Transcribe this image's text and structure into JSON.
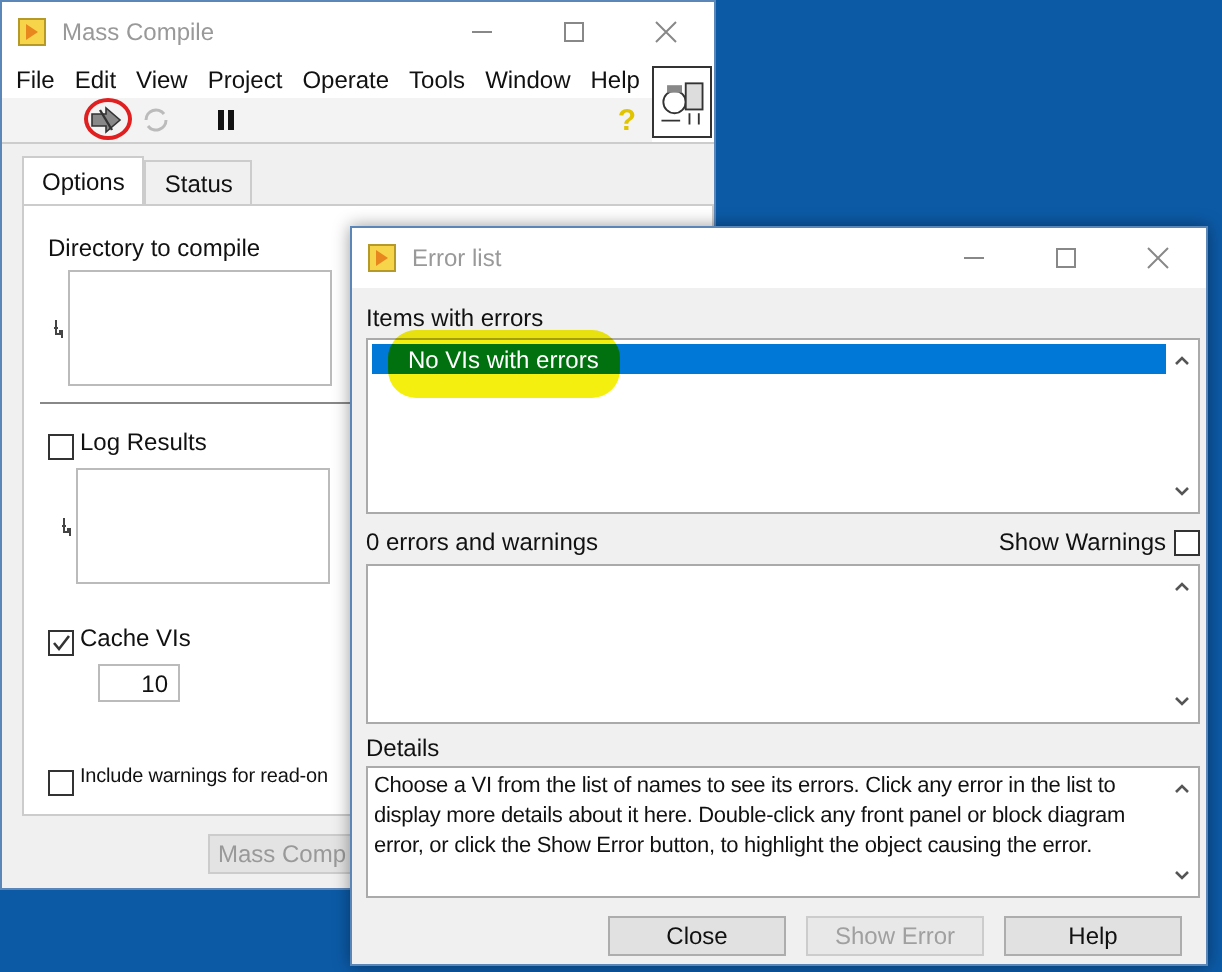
{
  "main_window": {
    "title": "Mass Compile",
    "menu": [
      "File",
      "Edit",
      "View",
      "Project",
      "Operate",
      "Tools",
      "Window",
      "Help"
    ],
    "help_glyph": "?",
    "tabs": [
      {
        "label": "Options",
        "selected": true
      },
      {
        "label": "Status",
        "selected": false
      }
    ],
    "directory_label": "Directory to compile",
    "log_results": {
      "label": "Log Results",
      "checked": false
    },
    "cache_vis": {
      "label": "Cache VIs",
      "checked": true,
      "value": "10"
    },
    "include_warnings": {
      "label": "Include warnings for read-on",
      "checked": false
    },
    "mass_compile_button": "Mass Comp"
  },
  "error_dialog": {
    "title": "Error list",
    "items_label": "Items with errors",
    "items": [
      {
        "label": "No VIs with errors",
        "selected": true
      }
    ],
    "count_label": "0 errors and warnings",
    "show_warnings": {
      "label": "Show Warnings",
      "checked": false
    },
    "details_label": "Details",
    "details_text": "Choose a VI from the list of names to see its errors. Click any error in the list to display more details about it here. Double-click any front panel or block diagram error, or click the Show Error button, to highlight the object causing the error.",
    "buttons": [
      {
        "label": "Close",
        "disabled": false
      },
      {
        "label": "Show Error",
        "disabled": true
      },
      {
        "label": "Help",
        "disabled": false
      }
    ]
  }
}
